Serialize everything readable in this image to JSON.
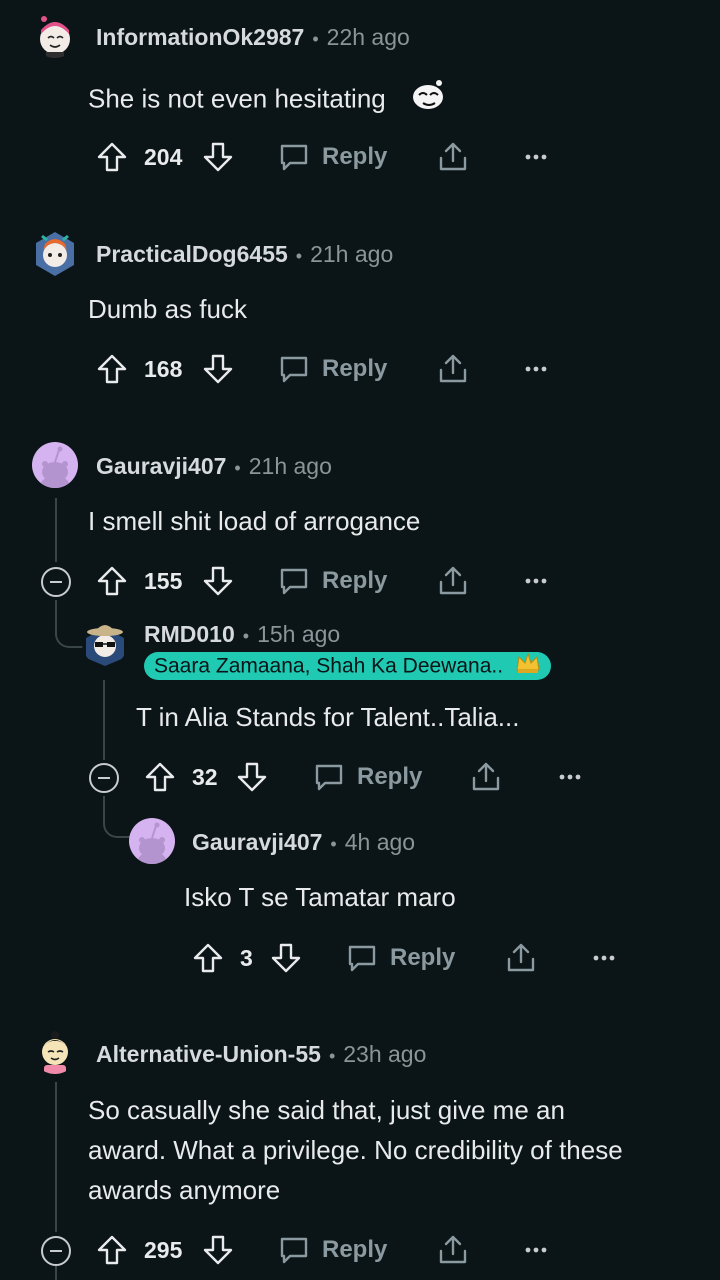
{
  "comments": [
    {
      "username": "InformationOk2987",
      "time": "22h ago",
      "text": "She is not even hesitating",
      "votes": "204",
      "reply": "Reply"
    },
    {
      "username": "PracticalDog6455",
      "time": "21h ago",
      "text": "Dumb as fuck",
      "votes": "168",
      "reply": "Reply"
    },
    {
      "username": "Gauravji407",
      "time": "21h ago",
      "text": "I smell shit load of arrogance",
      "votes": "155",
      "reply": "Reply"
    },
    {
      "username": "RMD010",
      "time": "15h ago",
      "flair": "Saara Zamaana, Shah Ka Deewana..",
      "text": "T in Alia Stands for Talent..Talia...",
      "votes": "32",
      "reply": "Reply"
    },
    {
      "username": "Gauravji407",
      "time": "4h ago",
      "text": "Isko T se Tamatar maro",
      "votes": "3",
      "reply": "Reply"
    },
    {
      "username": "Alternative-Union-55",
      "time": "23h ago",
      "text_lines": [
        "So casually she said that, just give me an",
        "award. What a privilege. No credibility of these",
        "awards anymore"
      ],
      "votes": "295",
      "reply": "Reply"
    }
  ],
  "icons": {
    "upvote": "upvote-icon",
    "downvote": "downvote-icon",
    "reply": "speech-bubble-icon",
    "share": "share-icon",
    "more": "more-icon",
    "collapse": "collapse-icon"
  },
  "colors": {
    "background": "#0b1416",
    "flair": "#1fc9b2",
    "avatar_purple": "#d5b3f0"
  }
}
